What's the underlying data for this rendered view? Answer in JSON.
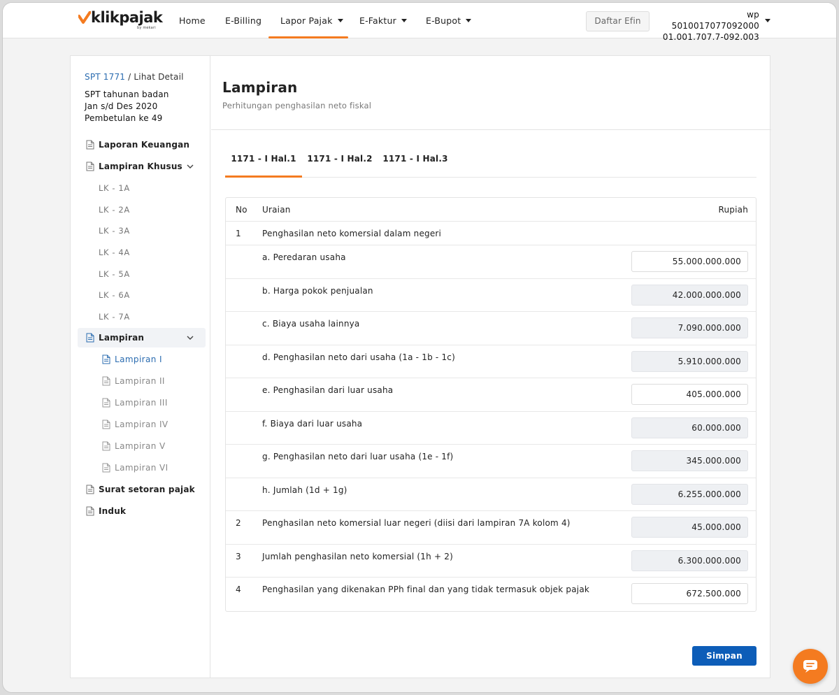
{
  "brand": {
    "name": "klikpajak",
    "tagline": "by mekari"
  },
  "nav": {
    "items": [
      {
        "label": "Home",
        "dropdown": false
      },
      {
        "label": "E-Billing",
        "dropdown": false
      },
      {
        "label": "Lapor Pajak",
        "dropdown": true
      },
      {
        "label": "E-Faktur",
        "dropdown": true
      },
      {
        "label": "E-Bupot",
        "dropdown": true
      }
    ],
    "active": "Lapor Pajak",
    "efin_button": "Daftar Efin",
    "account": {
      "name": "wp 5010017077092000",
      "npwp": "01.001.707.7-092.003"
    }
  },
  "colors": {
    "accent": "#f47b20",
    "primary": "#0d5db8",
    "link": "#2b6cb0"
  },
  "sidebar": {
    "breadcrumb": {
      "link": "SPT 1771",
      "separator": " / ",
      "current": "Lihat Detail"
    },
    "spt_info": [
      "SPT tahunan badan",
      "Jan s/d Des 2020",
      "Pembetulan ke 49"
    ],
    "items": [
      {
        "label": "Laporan Keuangan",
        "icon": "document-icon"
      },
      {
        "label": "Lampiran Khusus",
        "icon": "document-icon",
        "expanded": true,
        "children": [
          "LK - 1A",
          "LK - 2A",
          "LK - 3A",
          "LK - 4A",
          "LK - 5A",
          "LK - 6A",
          "LK - 7A"
        ]
      },
      {
        "label": "Lampiran",
        "icon": "document-icon",
        "expanded": true,
        "children": [
          "Lampiran I",
          "Lampiran II",
          "Lampiran III",
          "Lampiran IV",
          "Lampiran V",
          "Lampiran VI"
        ],
        "active_child": "Lampiran I"
      },
      {
        "label": "Surat setoran pajak",
        "icon": "document-icon"
      },
      {
        "label": "Induk",
        "icon": "document-icon"
      }
    ]
  },
  "content": {
    "title": "Lampiran",
    "subtitle": "Perhitungan penghasilan neto fiskal",
    "tabs": [
      "1171 - I Hal.1",
      "1171 - I Hal.2",
      "1171 - I Hal.3"
    ],
    "active_tab": "1171 - I Hal.1",
    "table": {
      "headers": {
        "no": "No",
        "desc": "Uraian",
        "amount": "Rupiah"
      },
      "rows": [
        {
          "no": "1",
          "desc": "Penghasilan neto komersial dalam negeri",
          "amount": null
        },
        {
          "no": "",
          "desc": "a. Peredaran usaha",
          "amount": "55.000.000.000",
          "editable": true
        },
        {
          "no": "",
          "desc": "b. Harga pokok penjualan",
          "amount": "42.000.000.000",
          "editable": false
        },
        {
          "no": "",
          "desc": "c. Biaya usaha lainnya",
          "amount": "7.090.000.000",
          "editable": false
        },
        {
          "no": "",
          "desc": "d. Penghasilan neto dari usaha (1a - 1b - 1c)",
          "amount": "5.910.000.000",
          "editable": false
        },
        {
          "no": "",
          "desc": "e. Penghasilan dari luar usaha",
          "amount": "405.000.000",
          "editable": true
        },
        {
          "no": "",
          "desc": "f. Biaya dari luar usaha",
          "amount": "60.000.000",
          "editable": false
        },
        {
          "no": "",
          "desc": "g. Penghasilan neto dari luar usaha (1e - 1f)",
          "amount": "345.000.000",
          "editable": false
        },
        {
          "no": "",
          "desc": "h. Jumlah (1d + 1g)",
          "amount": "6.255.000.000",
          "editable": false
        },
        {
          "no": "2",
          "desc": "Penghasilan neto komersial luar negeri (diisi dari lampiran 7A kolom 4)",
          "amount": "45.000.000",
          "editable": false
        },
        {
          "no": "3",
          "desc": "Jumlah penghasilan neto komersial (1h + 2)",
          "amount": "6.300.000.000",
          "editable": false
        },
        {
          "no": "4",
          "desc": "Penghasilan yang dikenakan PPh final dan yang tidak termasuk objek pajak",
          "amount": "672.500.000",
          "editable": true
        }
      ]
    },
    "save_button": "Simpan"
  }
}
